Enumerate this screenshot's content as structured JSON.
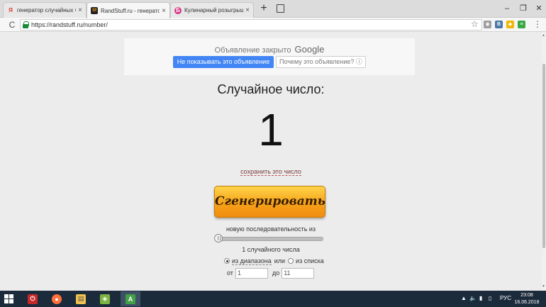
{
  "browser": {
    "tabs": [
      {
        "title": "генератор случайных чисел он",
        "favicon": "Я",
        "favicon_color": "#e53935",
        "active": false
      },
      {
        "title": "RandStuff.ru - генератор сл",
        "favicon": "Sf",
        "favicon_color": "#f6a21a",
        "active": true
      },
      {
        "title": "Кулинарный розыгрыш) - ок",
        "favicon": "Б",
        "favicon_color": "#d63384",
        "active": false
      }
    ],
    "tab_close": "×",
    "new_tab": "+",
    "window_controls": {
      "minimize": "–",
      "restore": "❐",
      "close": "✕"
    },
    "url": "https://randstuff.ru/number/",
    "reload_icon": "C",
    "bookmark_icon": "☆",
    "menu_icon": "⋮",
    "extensions": [
      {
        "name": "ext-grey",
        "color": "#9e9e9e",
        "glyph": "◉"
      },
      {
        "name": "vk",
        "color": "#4a76a8",
        "glyph": "В"
      },
      {
        "name": "chat",
        "color": "#f2b705",
        "glyph": "◆"
      },
      {
        "name": "green",
        "color": "#3aa845",
        "glyph": "≡"
      }
    ]
  },
  "ad": {
    "title": "Объявление закрыто",
    "brand": "Google",
    "hide_button": "Не показывать это объявление",
    "why_button": "Почему это объявление? ⓘ"
  },
  "main": {
    "heading": "Случайное число:",
    "result": "1",
    "save_link": "сохранить это число",
    "generate_button": "Сгенерировать",
    "sequence_label": "новую последовательность из",
    "count_label": "1 случайного числа",
    "radio_range": "из диапазона",
    "radio_or": "или",
    "radio_list": "из списка",
    "from_label": "от",
    "from_value": "1",
    "to_label": "до",
    "to_value": "11"
  },
  "taskbar": {
    "apps": [
      {
        "name": "power",
        "glyph": "⏻",
        "color": "#c62828"
      },
      {
        "name": "firefox",
        "glyph": "●",
        "color": "#ff7139"
      },
      {
        "name": "explorer",
        "glyph": "▤",
        "color": "#f2c14e"
      },
      {
        "name": "bluestacks",
        "glyph": "◈",
        "color": "#7cb342"
      },
      {
        "name": "app-green",
        "glyph": "A",
        "color": "#43a047"
      }
    ],
    "language": "РУС",
    "time": "23:08",
    "date": "16.06.2018"
  }
}
